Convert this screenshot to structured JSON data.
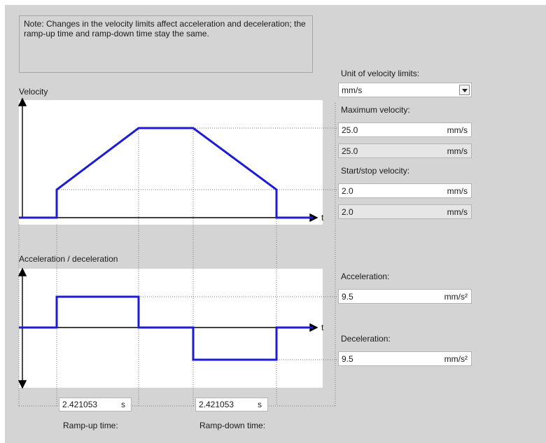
{
  "note": "Note: Changes in the velocity limits affect acceleration and deceleration; the ramp-up time and ramp-down time stay the same.",
  "velocity_chart": {
    "title": "Velocity",
    "axis_t": "t"
  },
  "accel_chart": {
    "title": "Acceleration / deceleration",
    "axis_t": "t"
  },
  "unit_limits": {
    "label": "Unit of velocity limits:",
    "value": "mm/s"
  },
  "max_velocity": {
    "label": "Maximum velocity:",
    "value": "25.0",
    "unit": "mm/s",
    "readonly_value": "25.0",
    "readonly_unit": "mm/s"
  },
  "start_stop_velocity": {
    "label": "Start/stop velocity:",
    "value": "2.0",
    "unit": "mm/s",
    "readonly_value": "2.0",
    "readonly_unit": "mm/s"
  },
  "acceleration": {
    "label": "Acceleration:",
    "value": "9.5",
    "unit": "mm/s²"
  },
  "deceleration": {
    "label": "Deceleration:",
    "value": "9.5",
    "unit": "mm/s²"
  },
  "ramp_up": {
    "label": "Ramp-up time:",
    "value": "2.421053",
    "unit": "s"
  },
  "ramp_down": {
    "label": "Ramp-down time:",
    "value": "2.421053",
    "unit": "s"
  },
  "colors": {
    "profile_line": "#1c1cd6",
    "background": "#d4d4d4"
  }
}
